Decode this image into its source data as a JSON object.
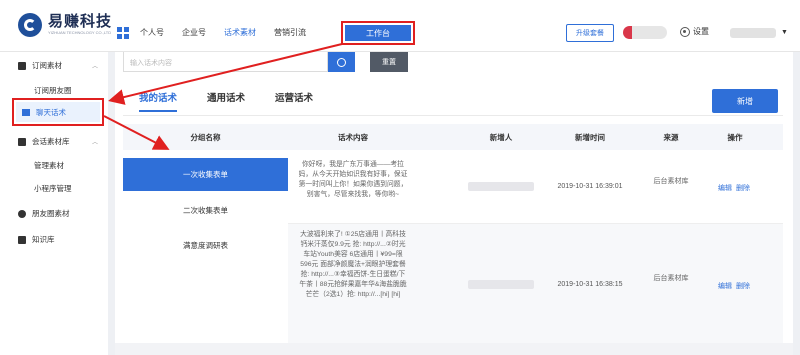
{
  "header": {
    "logo_text": "易赚科技",
    "logo_sub": "YIZHUAN TECHNOLOGY CO.,LTD",
    "nav": [
      "个人号",
      "企业号",
      "话术素材",
      "营销引流"
    ],
    "nav_active_index": 2,
    "workbench_label": "工作台",
    "upgrade_label": "升级套餐",
    "settings_label": "设置"
  },
  "sidebar": {
    "group1": "订阅素材",
    "group1_sub1": "订阅朋友圈",
    "active_item": "聊天话术",
    "group2": "会话素材库",
    "group2_sub1": "管理素材",
    "group2_sub2": "小程序管理",
    "item_moments": "朋友圈素材",
    "item_knowledge": "知识库"
  },
  "toolbar": {
    "search_placeholder": "输入话术内容",
    "reset_label": "重置",
    "add_label": "新增"
  },
  "tabs": [
    "我的话术",
    "通用话术",
    "运营话术"
  ],
  "table": {
    "headers": [
      "分组名称",
      "话术内容",
      "新增人",
      "新增时间",
      "来源",
      "操作"
    ],
    "groups": [
      "一次收集表单",
      "二次收集表单",
      "满意度调研表"
    ],
    "rows": [
      {
        "content": "你好呀，我是广东万事通——考拉妈，从今天开始如识我有好事，保证第一时间叫上你！如果你遇到问题，别害气，尽管来找我，等你哟~",
        "time": "2019-10-31 16:39:01",
        "source": "后台素材库",
        "edit": "编辑",
        "delete": "删除"
      },
      {
        "content": "大波福利来了! ①25店通用丨高科技钙米汗蒸仅9.9元 抢: http://...②时光车站Youth美容 6店通用丨¥99=限596元 面部净颜魔法+润眼护理套餐 抢: http://...③幸福西饼-生日蛋糕/下午茶丨88元抢鲜果嘉年华&海盐脆脆芒芒（2选1）抢: http://...[hi] [hi]",
        "time": "2019-10-31 16:38:15",
        "source": "后台素材库",
        "edit": "编辑",
        "delete": "删除"
      }
    ]
  }
}
